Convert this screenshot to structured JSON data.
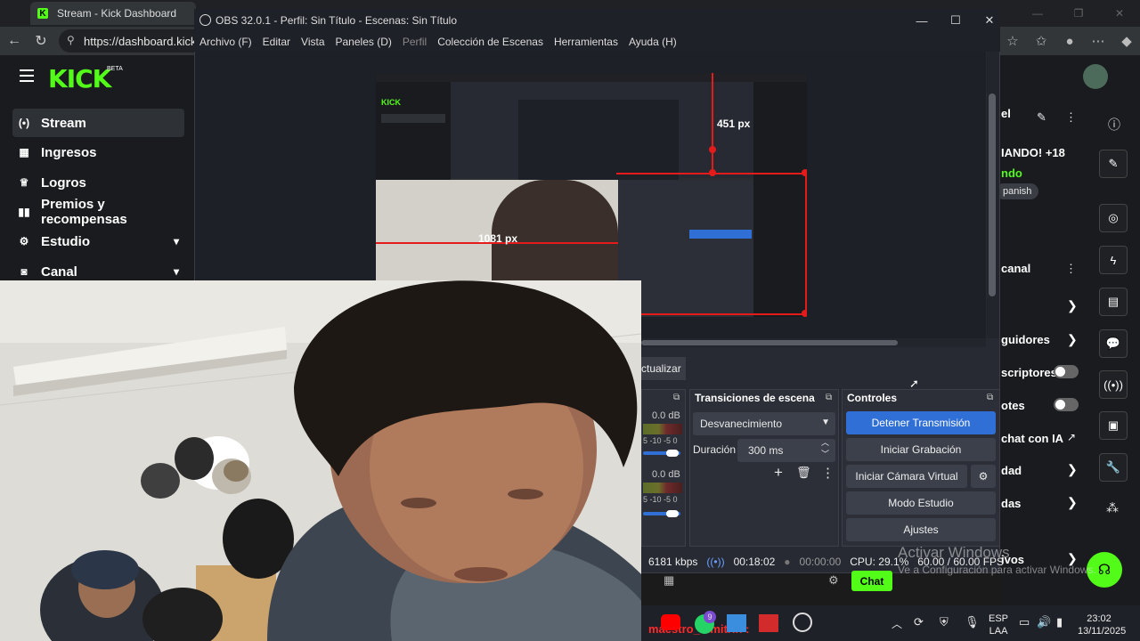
{
  "browser": {
    "tab_title": "Stream - Kick Dashboard",
    "url": "https://dashboard.kick.c"
  },
  "kick": {
    "logo": "KICK",
    "logo_badge": "BETA",
    "sidebar_items": [
      {
        "label": "Stream",
        "icon": "broadcast-icon",
        "glyph": "(•)"
      },
      {
        "label": "Ingresos",
        "icon": "chart-icon",
        "glyph": "▦"
      },
      {
        "label": "Logros",
        "icon": "trophy-icon",
        "glyph": "🏆"
      },
      {
        "label": "Premios y recompensas",
        "icon": "rewards-icon",
        "glyph": "▮▮"
      },
      {
        "label": "Estudio",
        "icon": "studio-icon",
        "glyph": "⚙"
      },
      {
        "label": "Canal",
        "icon": "channel-icon",
        "glyph": "◙"
      }
    ],
    "right_panel": {
      "title_fragment": "el",
      "stream_title_fragment": "IANDO! +18",
      "live_fragment": "ndo",
      "language_fragment": "panish",
      "section_fragment": "canal",
      "rows": [
        {
          "label": "guidores",
          "kind": "chevron"
        },
        {
          "label": "scriptores",
          "kind": "toggle"
        },
        {
          "label": "otes",
          "kind": "toggle"
        },
        {
          "label": "chat con IA",
          "kind": "external"
        },
        {
          "label": "dad",
          "kind": "chevron"
        },
        {
          "label": "das",
          "kind": "chevron"
        },
        {
          "label": "ivos",
          "kind": "chevron"
        }
      ],
      "chat_button": "Chat"
    }
  },
  "obs": {
    "window_title": "OBS 32.0.1 - Perfil: Sin Título - Escenas: Sin Título",
    "menu": [
      "Archivo (F)",
      "Editar",
      "Vista",
      "Paneles (D)",
      "Perfil",
      "Colección de Escenas",
      "Herramientas",
      "Ayuda (H)"
    ],
    "preview_labels": {
      "height": "451 px",
      "width": "1081 px"
    },
    "update_button": "ctualizar",
    "mixer": {
      "db1": "0.0 dB",
      "db2": "0.0 dB",
      "scale": "5 -10 -5 0"
    },
    "transitions": {
      "title": "Transiciones de escena",
      "selected": "Desvanecimiento",
      "duration_label": "Duración",
      "duration_value": "300 ms"
    },
    "controls": {
      "title": "Controles",
      "buttons": [
        "Detener Transmisión",
        "Iniciar Grabación",
        "Iniciar Cámara Virtual",
        "Modo Estudio",
        "Ajustes"
      ]
    },
    "status": {
      "bitrate": "6181 kbps",
      "stream_time": "00:18:02",
      "rec_time": "00:00:00",
      "cpu": "CPU: 29.1%",
      "fps": "60.00 / 60.00 FPS"
    }
  },
  "watermark": {
    "line1": "Activar Windows",
    "line2": "Ve a Configuración para activar Windows."
  },
  "taskbar": {
    "ticker": "maestro_dimitrih :",
    "lang1": "ESP",
    "lang2": "LAA",
    "time": "23:02",
    "date": "13/11/2025",
    "badge": "9"
  }
}
